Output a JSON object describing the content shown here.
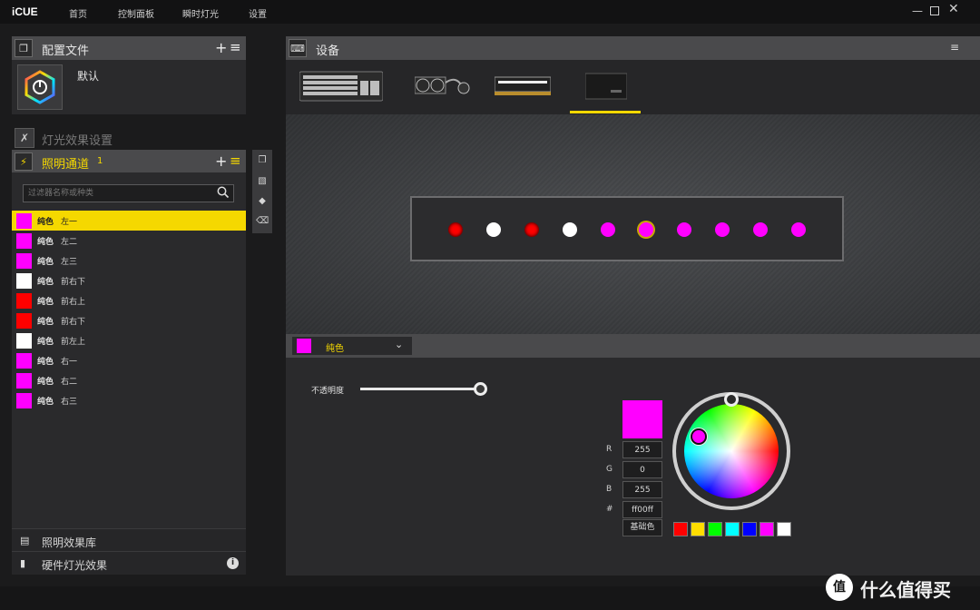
{
  "app": {
    "title": "iCUE"
  },
  "nav": [
    "首页",
    "控制面板",
    "瞬时灯光",
    "设置"
  ],
  "profiles": {
    "header": "配置文件",
    "add_symbol": "+",
    "menu_symbol": "≡",
    "default_name": "默认"
  },
  "lighting_setup": {
    "title": "灯光效果设置"
  },
  "channel": {
    "title": "照明通道",
    "count": "1",
    "add_symbol": "+",
    "menu_symbol": "≡"
  },
  "filter": {
    "placeholder": "过滤器名称或种类"
  },
  "layers": [
    {
      "type": "纯色",
      "name": "左一",
      "color": "#ff00ff",
      "selected": true
    },
    {
      "type": "纯色",
      "name": "左二",
      "color": "#ff00ff"
    },
    {
      "type": "纯色",
      "name": "左三",
      "color": "#ff00ff"
    },
    {
      "type": "纯色",
      "name": "前右下",
      "color": "#ffffff"
    },
    {
      "type": "纯色",
      "name": "前右上",
      "color": "#ff0000"
    },
    {
      "type": "纯色",
      "name": "前右下",
      "color": "#ff0000"
    },
    {
      "type": "纯色",
      "name": "前左上",
      "color": "#ffffff"
    },
    {
      "type": "纯色",
      "name": "右一",
      "color": "#ff00ff"
    },
    {
      "type": "纯色",
      "name": "右二",
      "color": "#ff00ff"
    },
    {
      "type": "纯色",
      "name": "右三",
      "color": "#ff00ff"
    }
  ],
  "library": {
    "effects_library": "照明效果库",
    "hardware_lighting": "硬件灯光效果"
  },
  "devices": {
    "header": "设备",
    "items": [
      "keyboard",
      "cooler",
      "memory",
      "fan-controller"
    ]
  },
  "leds": [
    "#ff0000",
    "#ffffff",
    "#ff0000",
    "#ffffff",
    "#ff00ff",
    "#ff00ff",
    "#ff00ff",
    "#ff00ff",
    "#ff00ff",
    "#ff00ff"
  ],
  "effect": {
    "name": "纯色",
    "color": "#ff00ff",
    "opacity_label": "不透明度",
    "opacity": 1.0,
    "r_label": "R",
    "r": "255",
    "g_label": "G",
    "g": "0",
    "b_label": "B",
    "b": "255",
    "hex_label": "#",
    "hex": "ff00ff",
    "basic_colors_label": "基础色",
    "presets": [
      "#ff0000",
      "#ffdd00",
      "#00ff00",
      "#00ffff",
      "#0000ff",
      "#ff00ff",
      "#ffffff"
    ]
  },
  "watermark": {
    "text": "什么值得买",
    "icon_text": "值"
  }
}
